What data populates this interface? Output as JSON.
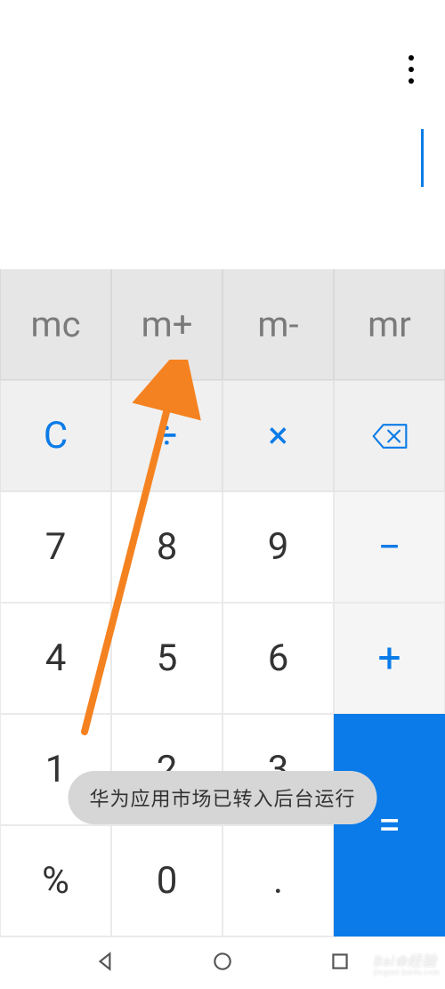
{
  "memory": {
    "mc": "mc",
    "mplus": "m+",
    "mminus": "m-",
    "mr": "mr"
  },
  "functions": {
    "clear": "C",
    "divide": "÷",
    "multiply": "×"
  },
  "digits": {
    "d0": "0",
    "d1": "1",
    "d2": "2",
    "d3": "3",
    "d4": "4",
    "d5": "5",
    "d6": "6",
    "d7": "7",
    "d8": "8",
    "d9": "9",
    "dot": ".",
    "percent": "%"
  },
  "operators": {
    "minus": "−",
    "plus": "+",
    "equals": "="
  },
  "toast": "华为应用市场已转入后台运行",
  "watermark": {
    "main": "Bai❀经验",
    "sub": "jingyan.baidu.com"
  },
  "colors": {
    "accent": "#0a7be8",
    "annotation": "#f58220"
  }
}
